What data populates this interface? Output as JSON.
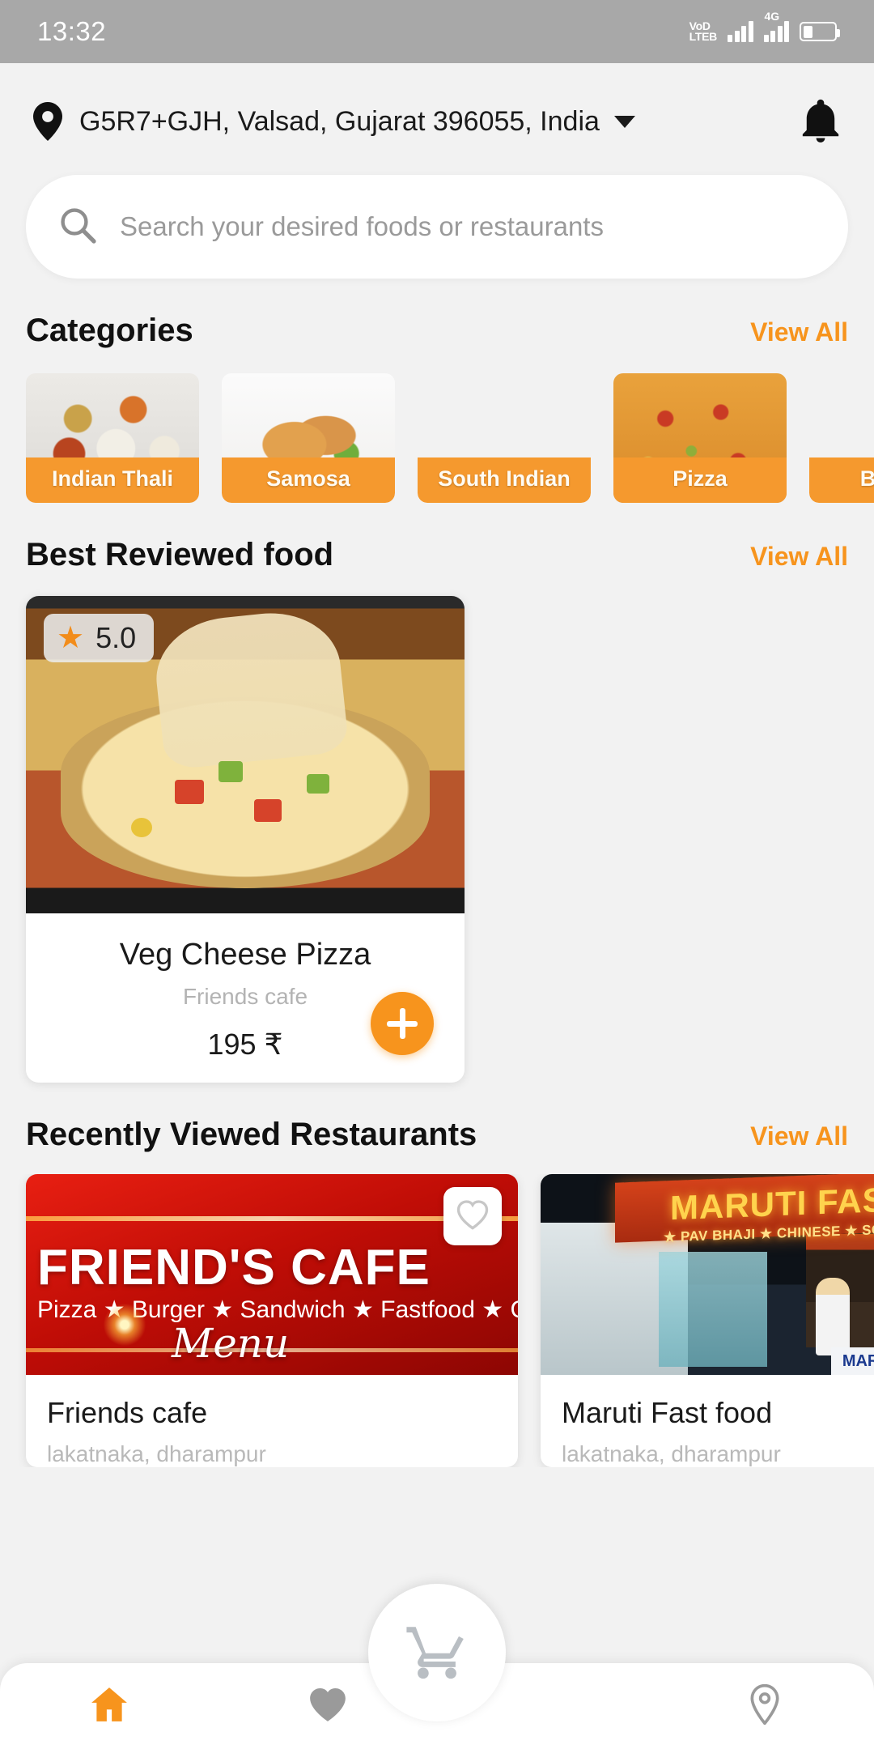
{
  "status_bar": {
    "time": "13:32",
    "volte_line1": "VoD",
    "volte_line2": "LTEB",
    "network_label": "4G"
  },
  "header": {
    "location_icon": "location-pin-icon",
    "location_text": "G5R7+GJH, Valsad, Gujarat 396055, India",
    "dropdown_icon": "chevron-down-icon",
    "notification_icon": "bell-icon"
  },
  "search": {
    "icon": "search-icon",
    "placeholder": "Search your desired foods or restaurants",
    "value": ""
  },
  "categories_section": {
    "title": "Categories",
    "view_all": "View All",
    "items": [
      {
        "label": "Indian Thali",
        "art": "thali"
      },
      {
        "label": "Samosa",
        "art": "samosa"
      },
      {
        "label": "South Indian",
        "art": "southindian"
      },
      {
        "label": "Pizza",
        "art": "pizza"
      },
      {
        "label": "Burger",
        "art": "burger"
      }
    ]
  },
  "best_reviewed_section": {
    "title": "Best Reviewed food",
    "view_all": "View All",
    "items": [
      {
        "rating": "5.0",
        "star_icon": "star-icon",
        "name": "Veg Cheese Pizza",
        "restaurant": "Friends cafe",
        "price": "195 ₹",
        "add_icon": "plus-icon"
      }
    ]
  },
  "recently_viewed_section": {
    "title": "Recently Viewed Restaurants",
    "view_all": "View All",
    "items": [
      {
        "banner_title": "FRIEND'S CAFE",
        "banner_subtitle": "Pizza ★ Burger ★ Sandwich ★ Fastfood ★ ColdCoffee",
        "banner_script": "Menu",
        "favorite_icon": "heart-icon",
        "name": "Friends cafe",
        "address": "lakatnaka, dharampur"
      },
      {
        "banner_title": "MARUTI FAST FOOD",
        "banner_subtitle": "★ PAV BHAJI  ★ CHINESE  ★ SOUTH INDIAN",
        "banner_board": "MARUTI PA",
        "name": "Maruti Fast food",
        "address": "lakatnaka, dharampur"
      }
    ]
  },
  "cart": {
    "icon": "shopping-cart-icon"
  },
  "bottom_nav": {
    "items": [
      {
        "icon": "home-icon"
      },
      {
        "icon": "heart-outline-icon"
      },
      {
        "icon": "location-pin-outline-icon"
      }
    ]
  },
  "colors": {
    "accent": "#f7941d",
    "category_label": "#f5992e",
    "page_background": "#f2f2f2",
    "status_bar": "#a8a8a8"
  }
}
